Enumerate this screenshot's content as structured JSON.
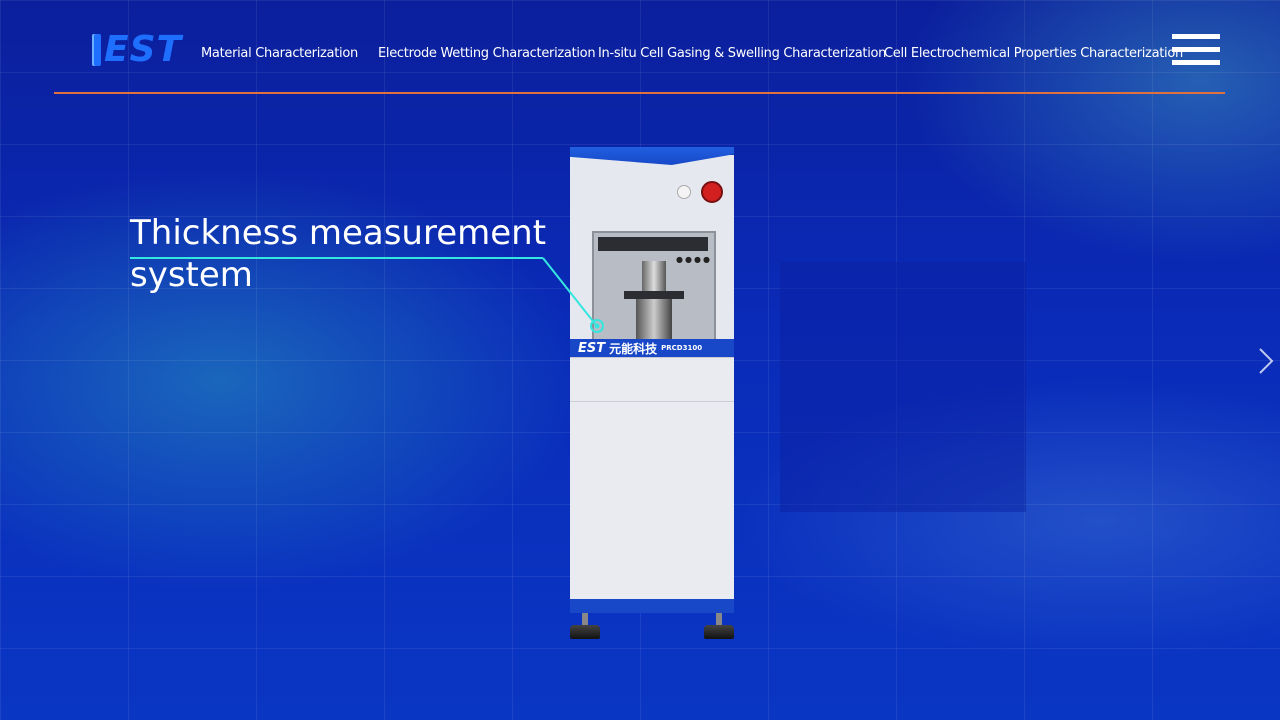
{
  "header": {
    "logo_text": "EST",
    "nav": [
      {
        "label": "Material Characterization"
      },
      {
        "label": "Electrode Wetting Characterization"
      },
      {
        "label": "In-situ Cell Gasing & Swelling Characterization"
      },
      {
        "label": "Cell Electrochemical Properties Characterization"
      }
    ],
    "menu_icon": "hamburger-menu-icon",
    "divider_color": "#e0703e"
  },
  "hero": {
    "headline_line1": "Thickness measurement",
    "headline_line2": "system",
    "callout_color": "#35e6e0"
  },
  "machine": {
    "brand_logo": "EST",
    "brand_name_cn": "元能科技",
    "model": "PRCD3100"
  },
  "carousel": {
    "next_icon": "chevron-right-icon"
  },
  "colors": {
    "background": "#0a2bb8",
    "logo": "#1f6fff",
    "machine_accent": "#1848c8"
  }
}
